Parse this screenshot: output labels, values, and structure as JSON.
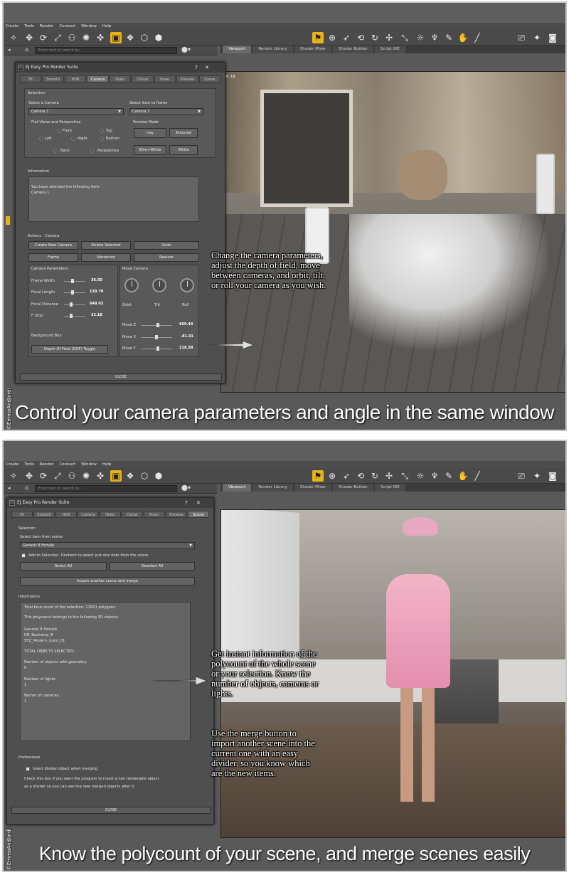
{
  "menu": [
    "Create",
    "Tools",
    "Render",
    "Connect",
    "Window",
    "Help"
  ],
  "viewport_tabs": [
    "Viewport",
    "Render Library",
    "Shader Mixer",
    "Shader Builder",
    "Script IDE"
  ],
  "search_placeholder": "Enter text to search by...",
  "frame_counter": "04: 18",
  "dialog_title": "EJ Easy Pro Render Suite",
  "dialog_help": "?",
  "dialog_close": "✕",
  "tabs": [
    "Fit",
    "Smooth",
    "HDR",
    "Camera",
    "Hider",
    "Cloner",
    "Poser",
    "Preview",
    "Scene"
  ],
  "panel1": {
    "active_tab": "Camera",
    "selection_header": "Selection",
    "select_camera_label": "Select a Camera",
    "select_camera_value": "Camera 1",
    "select_frame_label": "Select item to frame",
    "select_frame_value": "Camera 1",
    "flat_views_label": "Flat Views and Perspective",
    "views": [
      "Front",
      "Top",
      "Left",
      "Right",
      "Bottom",
      "Back",
      "Perspective"
    ],
    "preview_mode_label": "Preview Mode",
    "preview_buttons": [
      "Iray",
      "Textured",
      "Wire+White",
      "White"
    ],
    "information_header": "Information",
    "info_line1": "You have selected the following item:",
    "info_line2": "Camera 1",
    "actions_header": "Actions - Camera",
    "action_buttons": [
      "Create New Camera",
      "Delete Selected",
      "Undo",
      "Frame",
      "Memorize",
      "Restore"
    ],
    "camera_params_label": "Camera Parameters",
    "params": [
      {
        "label": "Frame Width",
        "value": "36.00"
      },
      {
        "label": "Focal Length",
        "value": "139.70"
      },
      {
        "label": "Focal Distance",
        "value": "648.03"
      },
      {
        "label": "F Stop",
        "value": "32.18"
      }
    ],
    "move_camera_label": "Move Camera",
    "dials": [
      "Orbit",
      "Tilt",
      "Roll"
    ],
    "moves": [
      {
        "label": "Move Z",
        "value": "660.44"
      },
      {
        "label": "Move X",
        "value": "-81.01"
      },
      {
        "label": "Move Y",
        "value": "218.58"
      }
    ],
    "background_blur_label": "Background Blur",
    "dof_button": "Depth Of Field (DOF) Toggle",
    "close_label": "CLOSE",
    "callout": "Change the camera parameters, adjust the depth of field, move between cameras, and orbit, tilt, or roll your camera as you wish.",
    "caption": "Control your camera parameters and angle in the same window"
  },
  "panel2": {
    "active_tab": "Scene",
    "selection_header": "Selection",
    "select_item_label": "Select item from scene",
    "select_item_value": "Genesis 8 Female",
    "add_selection_label": "Add to Selection. Uncheck to select just one item from the scene",
    "select_all": "Select All",
    "deselect_all": "Deselect All",
    "import_button": "Import another scene and merge",
    "information_header": "Information",
    "info_lines": [
      "Total face count of the selection: 21001 polygons.",
      "This polycount belongs to the following 3D objects:",
      "Genesis 8 Female",
      "RD_Backdrop_B",
      "STZ_Modern_room_01",
      "TOTAL OBJECTS SELECTED:",
      "Number of objects with geometry:",
      "0",
      "Number of lights:",
      "1",
      "Numer of cameras:",
      "1"
    ],
    "preferences_header": "Preferences",
    "insert_divider_label": "Insert divider object when merging",
    "pref_text1": "Check this box if you want the program to insert a non renderable object",
    "pref_text2": "as a divider so you can see the new merged objects after it.",
    "close_label": "CLOSE",
    "callout1": "Get instant information of the polycount of the whole scene or your selection. Know the number of objects, cameras or lights.",
    "callout2": "Use the merge button to import another scene into the current one with an easy divider, so you know which are the new items.",
    "caption": "Know the polycount of your scene, and merge scenes easily"
  },
  "watermark": "©EmmaAndJordi",
  "colors": {
    "accent_icon": "#e8b21a",
    "panel_bg": "#4f4f4f",
    "ui_bg": "#595959"
  }
}
